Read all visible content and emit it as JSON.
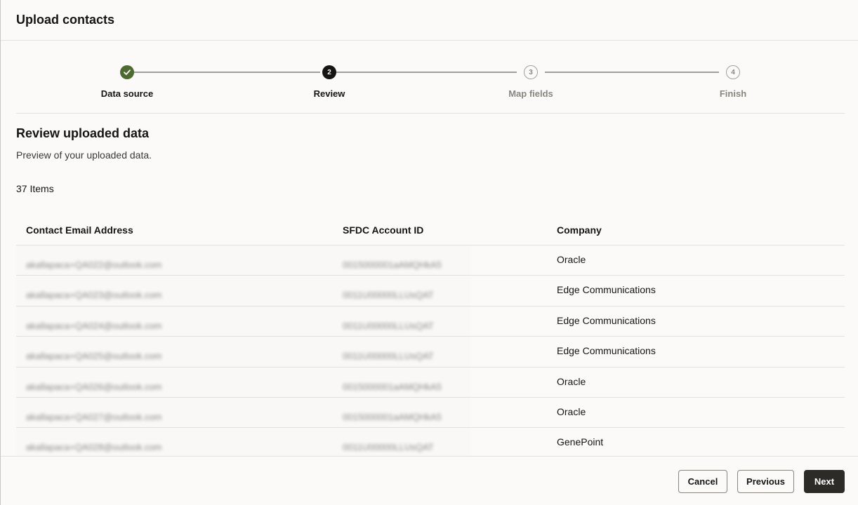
{
  "dialog": {
    "title": "Upload contacts"
  },
  "train": {
    "steps": [
      {
        "label": "Data source",
        "number": "",
        "state": "done"
      },
      {
        "label": "Review",
        "number": "2",
        "state": "current"
      },
      {
        "label": "Map fields",
        "number": "3",
        "state": "pending"
      },
      {
        "label": "Finish",
        "number": "4",
        "state": "pending"
      }
    ]
  },
  "section": {
    "title": "Review uploaded data",
    "subtitle": "Preview of your uploaded data.",
    "items_count": "37 Items"
  },
  "table": {
    "headers": [
      "Contact Email Address",
      "SFDC Account ID",
      "Company"
    ],
    "rows": [
      {
        "email": "akallapaca+QA022@outlook.com",
        "account": "0015000001aAMQHkA5",
        "company": "Oracle"
      },
      {
        "email": "akallapaca+QA023@outlook.com",
        "account": "0011U00000LLUsQAT",
        "company": "Edge Communications"
      },
      {
        "email": "akallapaca+QA024@outlook.com",
        "account": "0011U00000LLUsQAT",
        "company": "Edge Communications"
      },
      {
        "email": "akallapaca+QA025@outlook.com",
        "account": "0011U00000LLUsQAT",
        "company": "Edge Communications"
      },
      {
        "email": "akallapaca+QA026@outlook.com",
        "account": "0015000001aAMQHkA5",
        "company": "Oracle"
      },
      {
        "email": "akallapaca+QA027@outlook.com",
        "account": "0015000001aAMQHkA5",
        "company": "Oracle"
      },
      {
        "email": "akallapaca+QA028@outlook.com",
        "account": "0011U00000LLUsQAT",
        "company": "GenePoint"
      }
    ]
  },
  "footer": {
    "cancel_label": "Cancel",
    "previous_label": "Previous",
    "next_label": "Next"
  }
}
